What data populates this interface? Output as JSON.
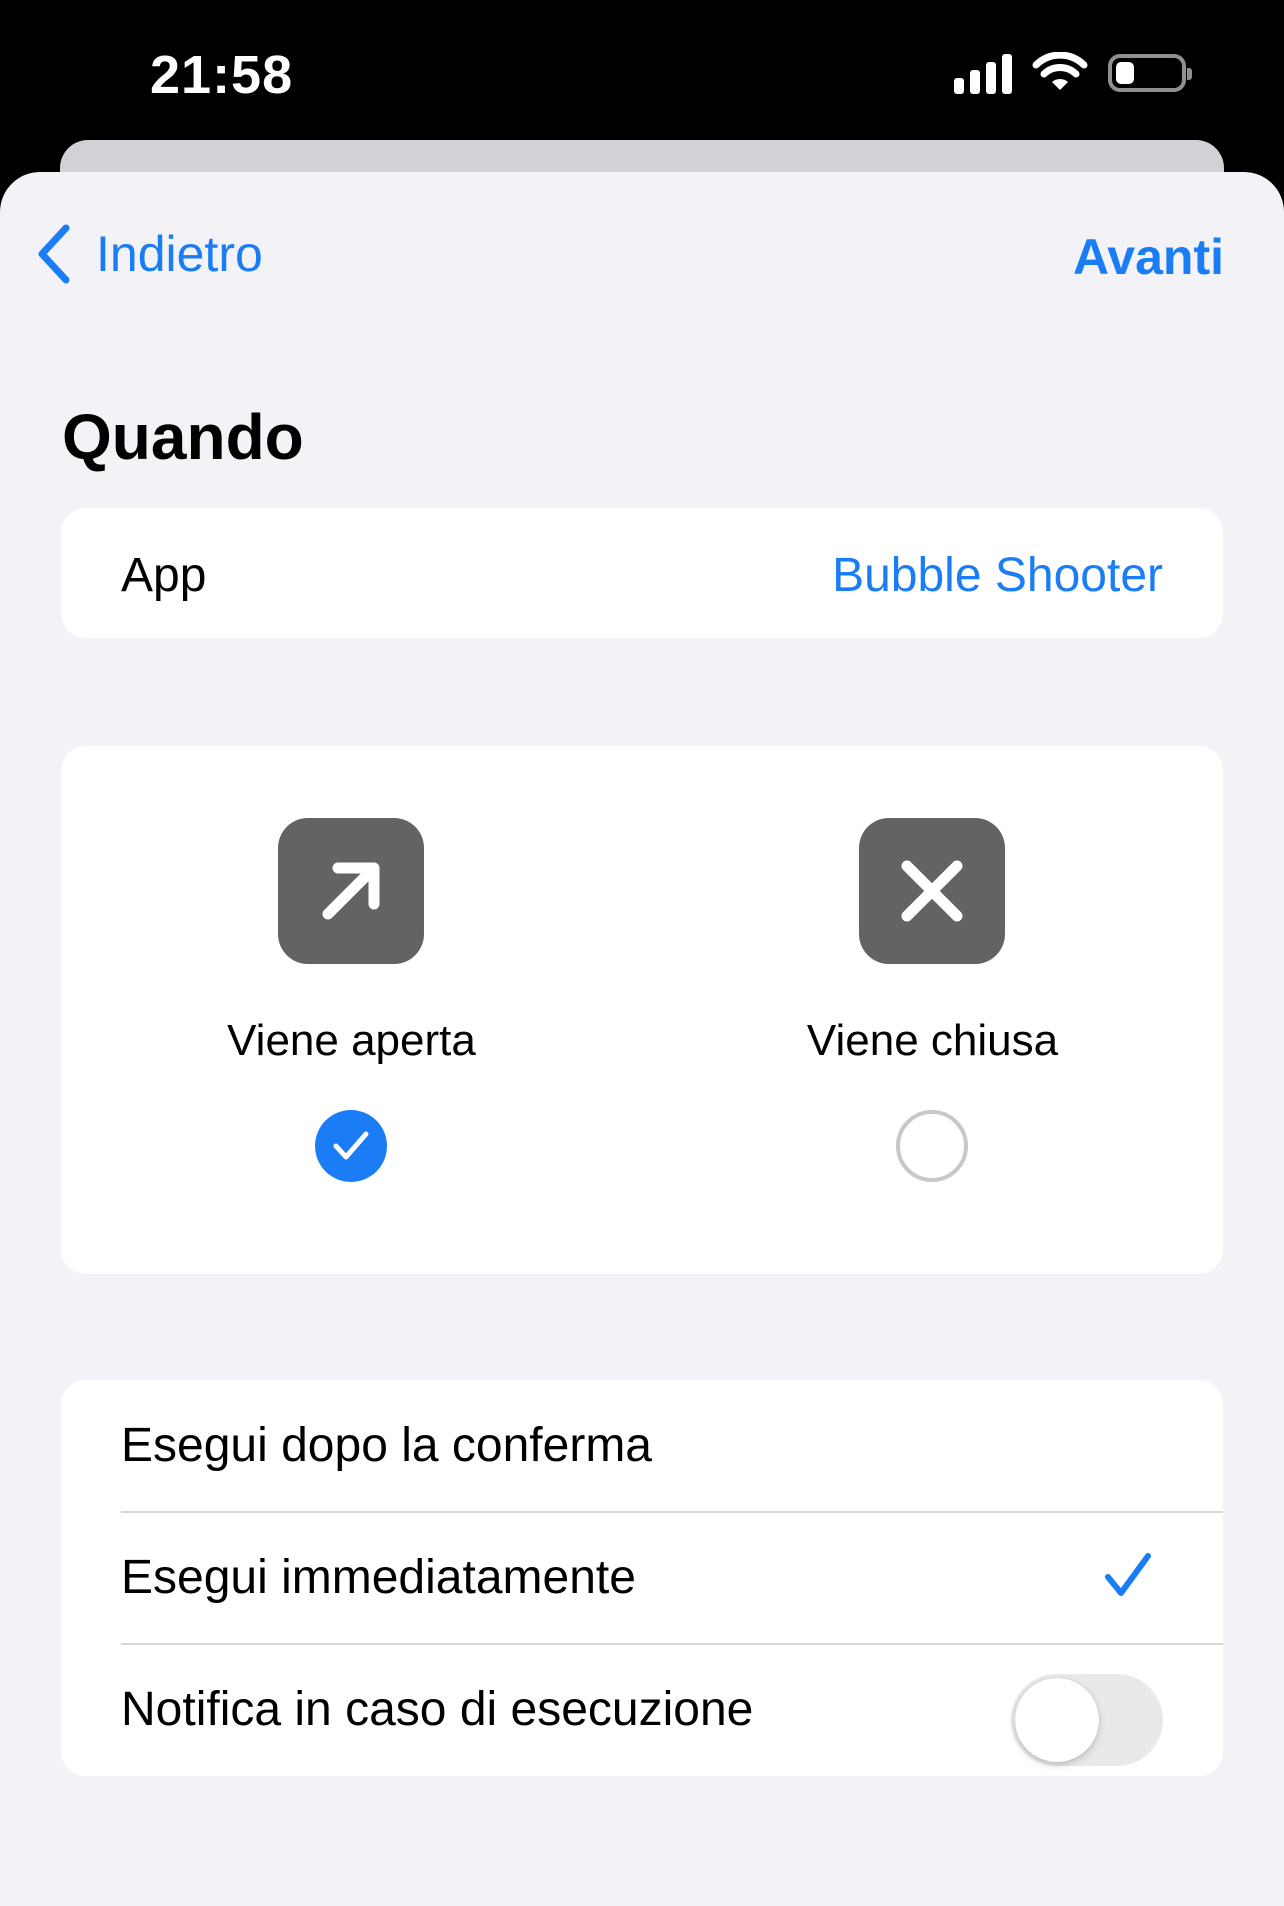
{
  "status_bar": {
    "time": "21:58",
    "battery_level": 0.2
  },
  "nav": {
    "back_label": "Indietro",
    "next_label": "Avanti",
    "accent_color": "#1a7df5"
  },
  "section": {
    "title": "Quando"
  },
  "app_row": {
    "label": "App",
    "value": "Bubble Shooter"
  },
  "choices": [
    {
      "label": "Viene aperta",
      "icon": "arrow-up-right-icon",
      "selected": true
    },
    {
      "label": "Viene chiusa",
      "icon": "xmark-icon",
      "selected": false
    }
  ],
  "options": {
    "confirm_label": "Esegui dopo la conferma",
    "immediate_label": "Esegui immediatamente",
    "immediate_checked": true,
    "notify_label": "Notifica in caso di esecuzione",
    "notify_enabled": false
  }
}
